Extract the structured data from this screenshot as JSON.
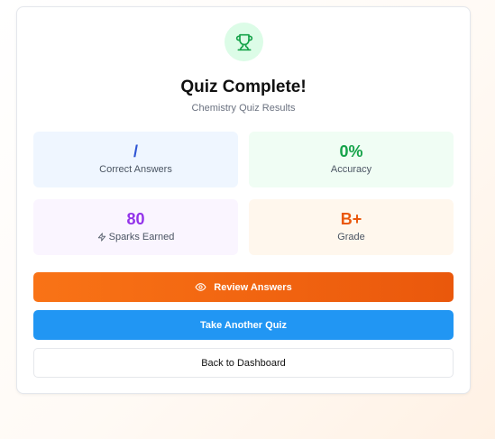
{
  "header": {
    "icon": "trophy-icon",
    "title": "Quiz Complete!",
    "subtitle": "Chemistry Quiz Results"
  },
  "stats": {
    "correct": {
      "value": "/",
      "label": "Correct Answers",
      "color": "#2f55d4"
    },
    "accuracy": {
      "value": "0%",
      "label": "Accuracy",
      "color": "#16a34a"
    },
    "sparks": {
      "value": "80",
      "label": "Sparks Earned",
      "icon": "lightning-icon",
      "color": "#9333ea"
    },
    "grade": {
      "value": "B+",
      "label": "Grade",
      "color": "#ea580c"
    }
  },
  "actions": {
    "review_label": "Review Answers",
    "review_icon": "eye-icon",
    "another_quiz_label": "Take Another Quiz",
    "dashboard_label": "Back to Dashboard"
  },
  "colors": {
    "review_button": "#f97316",
    "quiz_button": "#2196f3",
    "trophy_bg": "#dcfce7",
    "trophy": "#16a34a"
  }
}
